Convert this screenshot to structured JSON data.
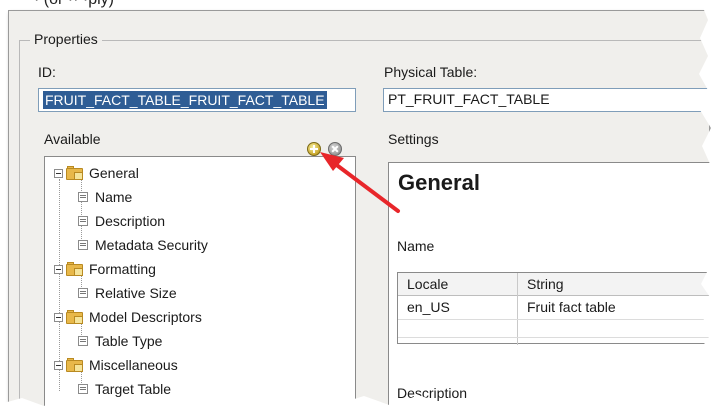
{
  "header_fragment": "· (or ·· ·ply)",
  "properties": {
    "legend": "Properties",
    "id_label": "ID:",
    "id_value": "FRUIT_FACT_TABLE_FRUIT_FACT_TABLE",
    "physical_table_label": "Physical Table:",
    "physical_table_value": "PT_FRUIT_FACT_TABLE"
  },
  "available": {
    "label": "Available",
    "add_icon": "add-icon",
    "remove_icon": "remove-icon",
    "tree": [
      {
        "label": "General",
        "type": "group"
      },
      {
        "label": "Name",
        "type": "property"
      },
      {
        "label": "Description",
        "type": "property"
      },
      {
        "label": "Metadata Security",
        "type": "property"
      },
      {
        "label": "Formatting",
        "type": "group"
      },
      {
        "label": "Relative Size",
        "type": "property"
      },
      {
        "label": "Model Descriptors",
        "type": "group"
      },
      {
        "label": "Table Type",
        "type": "property"
      },
      {
        "label": "Miscellaneous",
        "type": "group"
      },
      {
        "label": "Target Table",
        "type": "property"
      }
    ]
  },
  "settings": {
    "label": "Settings",
    "section_title": "General",
    "name_label": "Name",
    "table": {
      "columns": [
        "Locale",
        "String"
      ],
      "rows": [
        [
          "en_US",
          "Fruit fact table"
        ]
      ]
    },
    "description_label": "Description"
  },
  "colors": {
    "selection": "#2f5d95",
    "arrow": "#e8262a",
    "folder": "#e8b84a"
  }
}
